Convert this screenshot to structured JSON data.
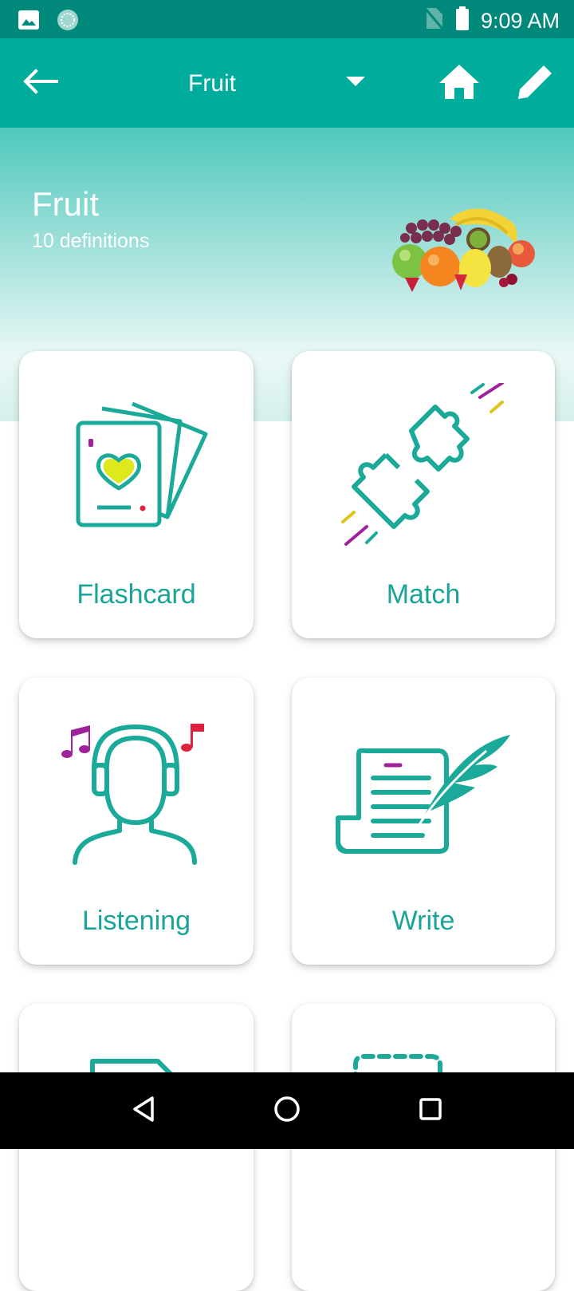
{
  "status_bar": {
    "time": "9:09 AM",
    "left_icons": [
      "image-icon",
      "sync-icon"
    ],
    "right_icons": [
      "no-sim-icon",
      "battery-icon"
    ]
  },
  "app_bar": {
    "title": "Fruit",
    "icons": {
      "back": "arrow-back-icon",
      "dropdown": "caret-down-icon",
      "home": "home-icon",
      "edit": "pencil-icon"
    }
  },
  "hero": {
    "title": "Fruit",
    "subtitle": "10 definitions",
    "image": "fruit-basket-image"
  },
  "modes": [
    {
      "label": "Flashcard",
      "icon": "flashcards-icon"
    },
    {
      "label": "Match",
      "icon": "puzzle-match-icon"
    },
    {
      "label": "Listening",
      "icon": "headphones-person-icon"
    },
    {
      "label": "Write",
      "icon": "scroll-quill-icon"
    },
    {
      "label": "",
      "icon": "document-icon"
    },
    {
      "label": "",
      "icon": "dashed-box-icon"
    }
  ],
  "nav_bar": {
    "icons": [
      "back-triangle-icon",
      "home-circle-icon",
      "recents-square-icon"
    ]
  },
  "colors": {
    "status_bar": "#00897B",
    "app_bar": "#00AC9B",
    "accent": "#19A497",
    "icon_teal": "#1BAA99"
  }
}
